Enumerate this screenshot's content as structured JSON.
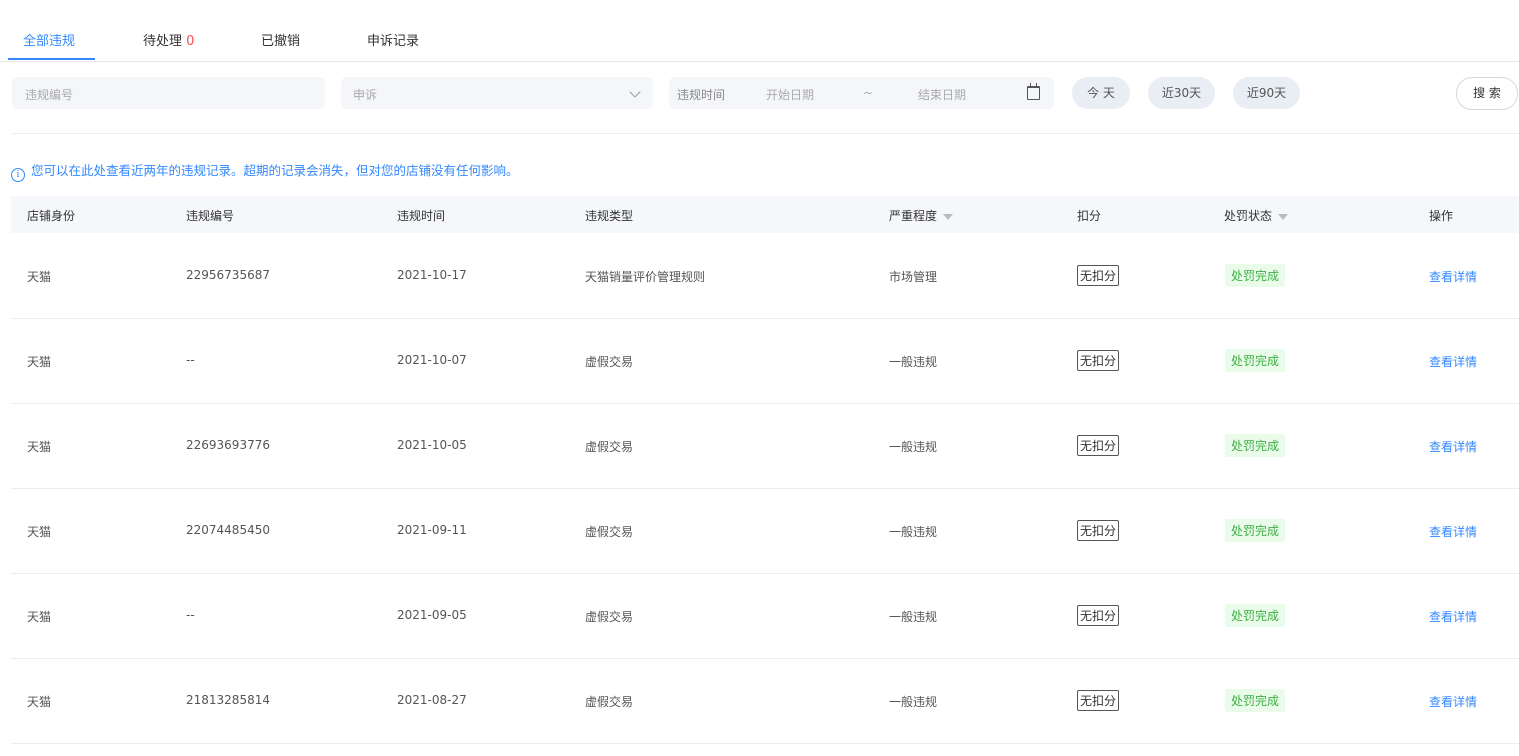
{
  "tabs": [
    {
      "label": "全部违规",
      "count": ""
    },
    {
      "label": "待处理",
      "count": "0"
    },
    {
      "label": "已撤销",
      "count": ""
    },
    {
      "label": "申诉记录",
      "count": ""
    }
  ],
  "filters": {
    "violation_id_placeholder": "违规编号",
    "appeal_select_placeholder": "申诉",
    "time_label": "违规时间",
    "start_placeholder": "开始日期",
    "range_sep": "~",
    "end_placeholder": "结束日期",
    "quick": [
      "今 天",
      "近30天",
      "近90天"
    ],
    "search_label": "搜 索"
  },
  "notice": {
    "icon": "info-icon",
    "text": "您可以在此处查看近两年的违规记录。超期的记录会消失，但对您的店铺没有任何影响。"
  },
  "table": {
    "columns": [
      "店铺身份",
      "违规编号",
      "违规时间",
      "违规类型",
      "严重程度",
      "扣分",
      "处罚状态",
      "操作"
    ],
    "rows": [
      {
        "shop": "天猫",
        "id": "22956735687",
        "date": "2021-10-17",
        "type": "天猫销量评价管理规则",
        "severity": "市场管理",
        "score": "无扣分",
        "status": "处罚完成",
        "action": "查看详情"
      },
      {
        "shop": "天猫",
        "id": "--",
        "date": "2021-10-07",
        "type": "虚假交易",
        "severity": "一般违规",
        "score": "无扣分",
        "status": "处罚完成",
        "action": "查看详情"
      },
      {
        "shop": "天猫",
        "id": "22693693776",
        "date": "2021-10-05",
        "type": "虚假交易",
        "severity": "一般违规",
        "score": "无扣分",
        "status": "处罚完成",
        "action": "查看详情"
      },
      {
        "shop": "天猫",
        "id": "22074485450",
        "date": "2021-09-11",
        "type": "虚假交易",
        "severity": "一般违规",
        "score": "无扣分",
        "status": "处罚完成",
        "action": "查看详情"
      },
      {
        "shop": "天猫",
        "id": "--",
        "date": "2021-09-05",
        "type": "虚假交易",
        "severity": "一般违规",
        "score": "无扣分",
        "status": "处罚完成",
        "action": "查看详情"
      },
      {
        "shop": "天猫",
        "id": "21813285814",
        "date": "2021-08-27",
        "type": "虚假交易",
        "severity": "一般违规",
        "score": "无扣分",
        "status": "处罚完成",
        "action": "查看详情"
      }
    ]
  },
  "colors": {
    "accent": "#3388ff",
    "count": "#ff4d4f",
    "status_text": "#3cb043",
    "status_bg": "#eafbea"
  }
}
